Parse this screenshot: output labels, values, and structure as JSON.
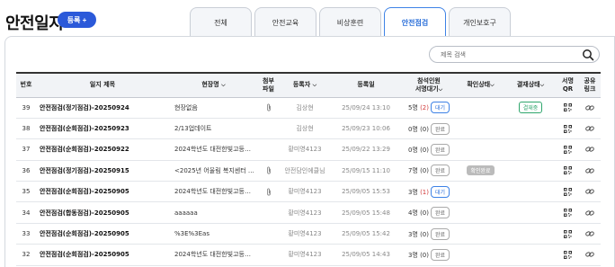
{
  "header": {
    "title": "안전일지",
    "register_label": "등록 +"
  },
  "tabs": [
    "전체",
    "안전교육",
    "비상훈련",
    "안전점검",
    "개인보호구"
  ],
  "active_tab": 3,
  "search": {
    "placeholder": "제목 검색"
  },
  "columns": {
    "no": "번호",
    "title": "일지 제목",
    "site": "현장명",
    "attach_1": "첨부",
    "attach_2": "파일",
    "registrant": "등록자",
    "date": "등록일",
    "attendees_1": "참석인원",
    "attendees_2": "서명대기",
    "confirm_status": "확인상태",
    "approval_status": "결재상태",
    "signature_qr": "서명QR",
    "share_1": "공유",
    "share_2": "링크"
  },
  "rows": [
    {
      "no": "39",
      "title": "안전점검(정기점검)-20250924",
      "site": "현장없음",
      "attach": true,
      "registrant": "김상현",
      "date": "25/09/24 13:10",
      "count": "5명",
      "pending": "(2)",
      "sign_status": "대기",
      "confirm": "",
      "approval": "결재중"
    },
    {
      "no": "38",
      "title": "안전점검(순회점검)-20250923",
      "site": "2/13업데이트",
      "attach": false,
      "registrant": "김상현",
      "date": "25/09/23 10:06",
      "count": "0명",
      "pending": "(0)",
      "sign_status": "완료",
      "confirm": "",
      "approval": ""
    },
    {
      "no": "37",
      "title": "안전점검(순회점검)-20250922",
      "site": "2024학년도 대전한빛고등학…",
      "attach": false,
      "registrant": "황미영4123",
      "date": "25/09/22 13:29",
      "count": "0명",
      "pending": "(0)",
      "sign_status": "완료",
      "confirm": "",
      "approval": ""
    },
    {
      "no": "36",
      "title": "안전점검(정기점검)-20250915",
      "site": "<2025년 어울림 복지센터 신…",
      "attach": true,
      "registrant": "안전담인에클님",
      "date": "25/09/15 11:10",
      "count": "7명",
      "pending": "(0)",
      "sign_status": "완료",
      "confirm": "확인완료",
      "approval": ""
    },
    {
      "no": "35",
      "title": "안전점검(순회점검)-20250905",
      "site": "2024학년도 대전한빛고등학…",
      "attach": true,
      "registrant": "황미영4123",
      "date": "25/09/05 15:53",
      "count": "3명",
      "pending": "(1)",
      "sign_status": "대기",
      "confirm": "",
      "approval": ""
    },
    {
      "no": "34",
      "title": "안전점검(합동점검)-20250905",
      "site": "aaaaaa",
      "attach": false,
      "registrant": "황미영4123",
      "date": "25/09/05 15:48",
      "count": "4명",
      "pending": "(0)",
      "sign_status": "완료",
      "confirm": "",
      "approval": ""
    },
    {
      "no": "33",
      "title": "안전점검(순회점검)-20250905",
      "site": "%3E%3Eas",
      "attach": false,
      "registrant": "황미영4123",
      "date": "25/09/05 15:42",
      "count": "3명",
      "pending": "(0)",
      "sign_status": "완료",
      "confirm": "",
      "approval": ""
    },
    {
      "no": "32",
      "title": "안전점검(순회점검)-20250905",
      "site": "2024학년도 대전한빛고등학…",
      "attach": false,
      "registrant": "황미영4123",
      "date": "25/09/05 14:43",
      "count": "3명",
      "pending": "(0)",
      "sign_status": "완료",
      "confirm": "",
      "approval": ""
    }
  ],
  "colors": {
    "accent": "#2b59d9",
    "tab_active": "#3d82e6",
    "pending_red": "#d23a3a",
    "approval_green": "#2ea66c"
  },
  "icons": {
    "search": "search-icon",
    "attach": "paperclip-icon",
    "qr": "qr-code-icon",
    "share": "link-icon",
    "sort": "chevron-down-icon"
  }
}
